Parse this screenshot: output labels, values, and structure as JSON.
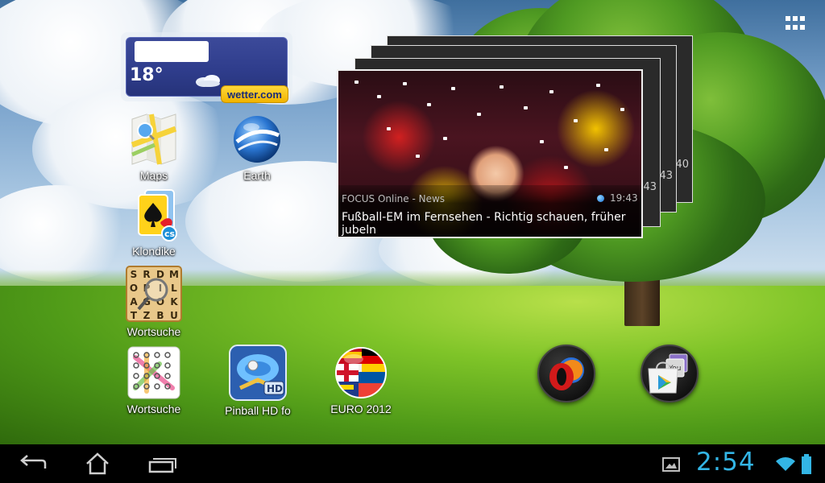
{
  "weather": {
    "temperature": "18°",
    "brand": "wetter.com",
    "condition_icon": "cloudy-icon"
  },
  "apps": [
    {
      "id": "maps",
      "label": "Maps",
      "icon": "maps-icon"
    },
    {
      "id": "earth",
      "label": "Earth",
      "icon": "google-earth-icon"
    },
    {
      "id": "klondike",
      "label": "Klondike",
      "icon": "spade-card-icon"
    },
    {
      "id": "wortsuche1",
      "label": "Wortsuche",
      "icon": "word-search-grid-icon",
      "letters": [
        "S",
        "R",
        "D",
        "M",
        "O",
        "P",
        "I",
        "L",
        "A",
        "G",
        "O",
        "K",
        "T",
        "Z",
        "B",
        "U"
      ]
    },
    {
      "id": "wortsuche2",
      "label": "Wortsuche",
      "icon": "word-search-dots-icon"
    },
    {
      "id": "pinball",
      "label": "Pinball HD fo",
      "icon": "pinball-icon",
      "badge": "HD"
    },
    {
      "id": "euro2012",
      "label": "EURO 2012",
      "icon": "flag-ball-icon"
    }
  ],
  "dock": [
    {
      "id": "opera",
      "icon": "opera-browser-icon"
    },
    {
      "id": "store",
      "icon": "play-store-folder-icon"
    }
  ],
  "news": {
    "source": "FOCUS Online - News",
    "time": "19:43",
    "headline": "Fußball-EM im Fernsehen - Richtig schauen, früher jubeln",
    "back_stamps": [
      "43",
      "43",
      "40"
    ]
  },
  "all_apps_icon": "grid-icon",
  "system_bar": {
    "back_icon": "back-icon",
    "home_icon": "home-icon",
    "recents_icon": "recent-apps-icon",
    "gallery_icon": "image-icon",
    "clock": "2:54",
    "wifi_icon": "wifi-icon",
    "battery_icon": "battery-icon"
  },
  "colors": {
    "accent": "#33b5e5",
    "weather_bg": "#2f3d8c",
    "weather_brand_bg": "#f2b400"
  }
}
